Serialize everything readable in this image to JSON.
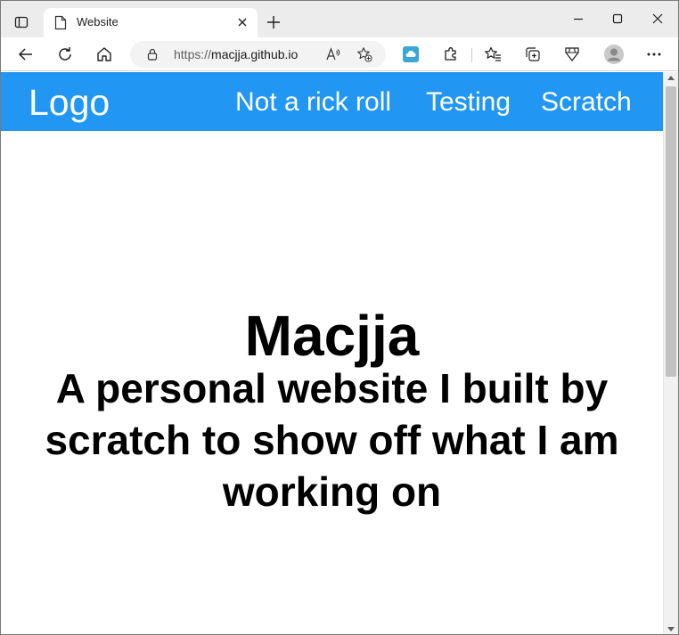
{
  "browser": {
    "tab": {
      "title": "Website"
    },
    "address": {
      "protocol": "https://",
      "host": "macjja.github.io"
    }
  },
  "page": {
    "nav": {
      "logo": "Logo",
      "links": [
        "Not a rick roll",
        "Testing",
        "Scratch"
      ]
    },
    "hero": {
      "title": "Macjja",
      "subtitle": "A personal website I built by scratch to show off what I am working on"
    }
  },
  "colors": {
    "navbar": "#2196f3",
    "chrome": "#ececec"
  },
  "icons": [
    "tab-actions-icon",
    "page-favicon-icon",
    "close-icon",
    "plus-icon",
    "minimize-icon",
    "maximize-icon",
    "close-window-icon",
    "back-icon",
    "refresh-icon",
    "home-icon",
    "lock-icon",
    "read-aloud-icon",
    "add-favorite-icon",
    "extension-cloud-icon",
    "extensions-icon",
    "favorites-icon",
    "collections-icon",
    "browser-essentials-icon",
    "profile-icon",
    "more-icon"
  ]
}
